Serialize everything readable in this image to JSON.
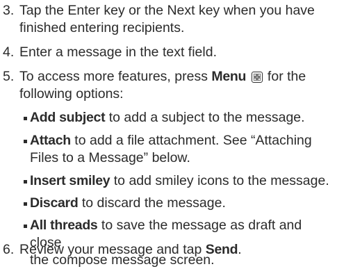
{
  "steps": [
    {
      "num": "3.",
      "lines": [
        "Tap the Enter key or the Next key when you have",
        "finished entering recipients."
      ]
    },
    {
      "num": "4.",
      "lines": [
        "Enter a message in the text field."
      ]
    },
    {
      "num": "5.",
      "pre": "To access more features, press ",
      "menu_label": "Menu",
      "post": " for the",
      "line2": "following options:"
    },
    {
      "num": "6.",
      "pre": "Review your message and tap ",
      "send_label": "Send",
      "post": "."
    }
  ],
  "options": [
    {
      "label": "Add subject",
      "desc": " to add a subject to the message."
    },
    {
      "label": "Attach",
      "desc": " to add a file attachment. See “Attaching",
      "desc2": "Files to a Message” below."
    },
    {
      "label": "Insert smiley",
      "desc": " to add smiley icons to the message."
    },
    {
      "label": "Discard",
      "desc": " to discard the message."
    },
    {
      "label": "All threads",
      "desc": " to save the message as draft and close",
      "desc2": "the compose message screen."
    }
  ],
  "icons": {
    "menu_key": "menu-key-icon"
  },
  "colors": {
    "text": "#2b2b2b"
  }
}
